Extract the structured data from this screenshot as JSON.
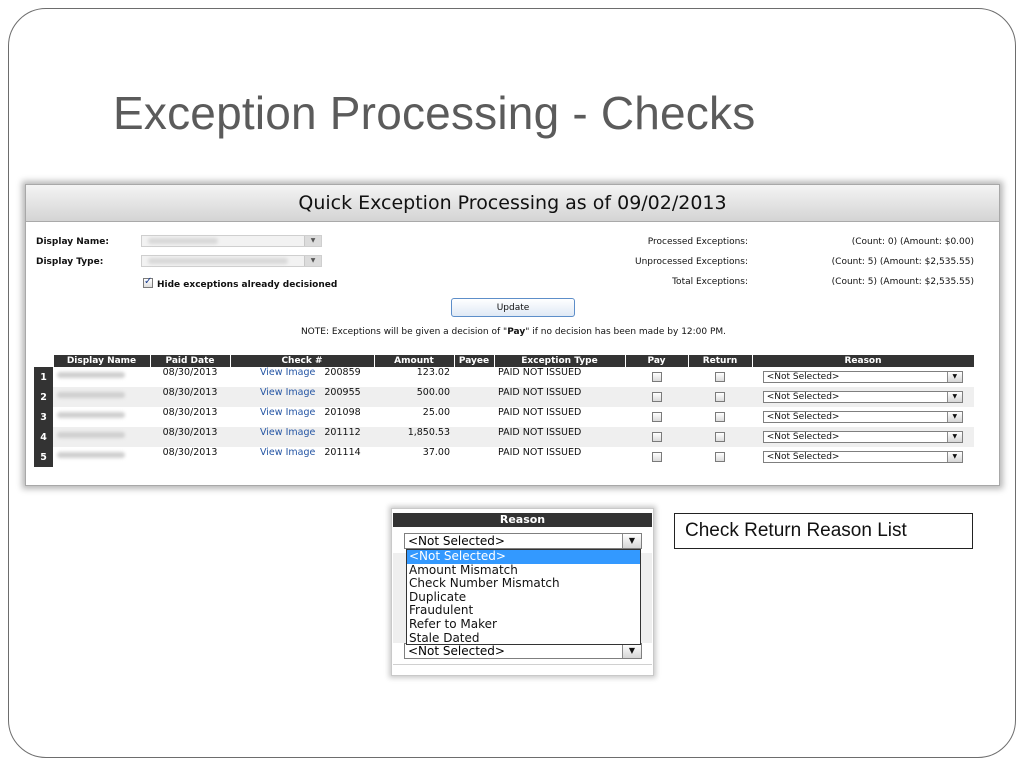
{
  "slide": {
    "title": "Exception Processing - Checks"
  },
  "panel": {
    "header": "Quick Exception Processing as of 09/02/2013",
    "display_name_label": "Display Name:",
    "display_type_label": "Display Type:",
    "hide_label": "Hide exceptions already decisioned",
    "update_label": "Update",
    "note_prefix": "NOTE: Exceptions will be given a decision of \"",
    "note_bold": "Pay",
    "note_suffix": "\" if no decision has been made by 12:00 PM.",
    "summary": [
      {
        "label": "Processed Exceptions:",
        "value": "(Count: 0) (Amount: $0.00)"
      },
      {
        "label": "Unprocessed Exceptions:",
        "value": "(Count: 5) (Amount: $2,535.55)"
      },
      {
        "label": "Total Exceptions:",
        "value": "(Count: 5) (Amount: $2,535.55)"
      }
    ]
  },
  "table": {
    "headers": [
      "Display Name",
      "Paid Date",
      "Check #",
      "Amount",
      "Payee",
      "Exception Type",
      "Pay",
      "Return",
      "Reason"
    ],
    "rows": [
      {
        "num": "1",
        "paid_date": "08/30/2013",
        "link": "View Image",
        "check": "200859",
        "amount": "123.02",
        "type": "PAID NOT ISSUED",
        "reason": "<Not Selected>"
      },
      {
        "num": "2",
        "paid_date": "08/30/2013",
        "link": "View Image",
        "check": "200955",
        "amount": "500.00",
        "type": "PAID NOT ISSUED",
        "reason": "<Not Selected>"
      },
      {
        "num": "3",
        "paid_date": "08/30/2013",
        "link": "View Image",
        "check": "201098",
        "amount": "25.00",
        "type": "PAID NOT ISSUED",
        "reason": "<Not Selected>"
      },
      {
        "num": "4",
        "paid_date": "08/30/2013",
        "link": "View Image",
        "check": "201112",
        "amount": "1,850.53",
        "type": "PAID NOT ISSUED",
        "reason": "<Not Selected>"
      },
      {
        "num": "5",
        "paid_date": "08/30/2013",
        "link": "View Image",
        "check": "201114",
        "amount": "37.00",
        "type": "PAID NOT ISSUED",
        "reason": "<Not Selected>"
      }
    ]
  },
  "inset": {
    "header": "Reason",
    "selected": "<Not Selected>",
    "options": [
      "<Not Selected>",
      "Amount Mismatch",
      "Check Number Mismatch",
      "Duplicate",
      "Fraudulent",
      "Refer to Maker",
      "Stale Dated"
    ],
    "bottom_select": "<Not Selected>"
  },
  "callout": {
    "text": "Check Return Reason List"
  },
  "icons": {
    "dropdown_arrow": "dropdown-arrow-icon",
    "check": "checkmark-icon"
  }
}
